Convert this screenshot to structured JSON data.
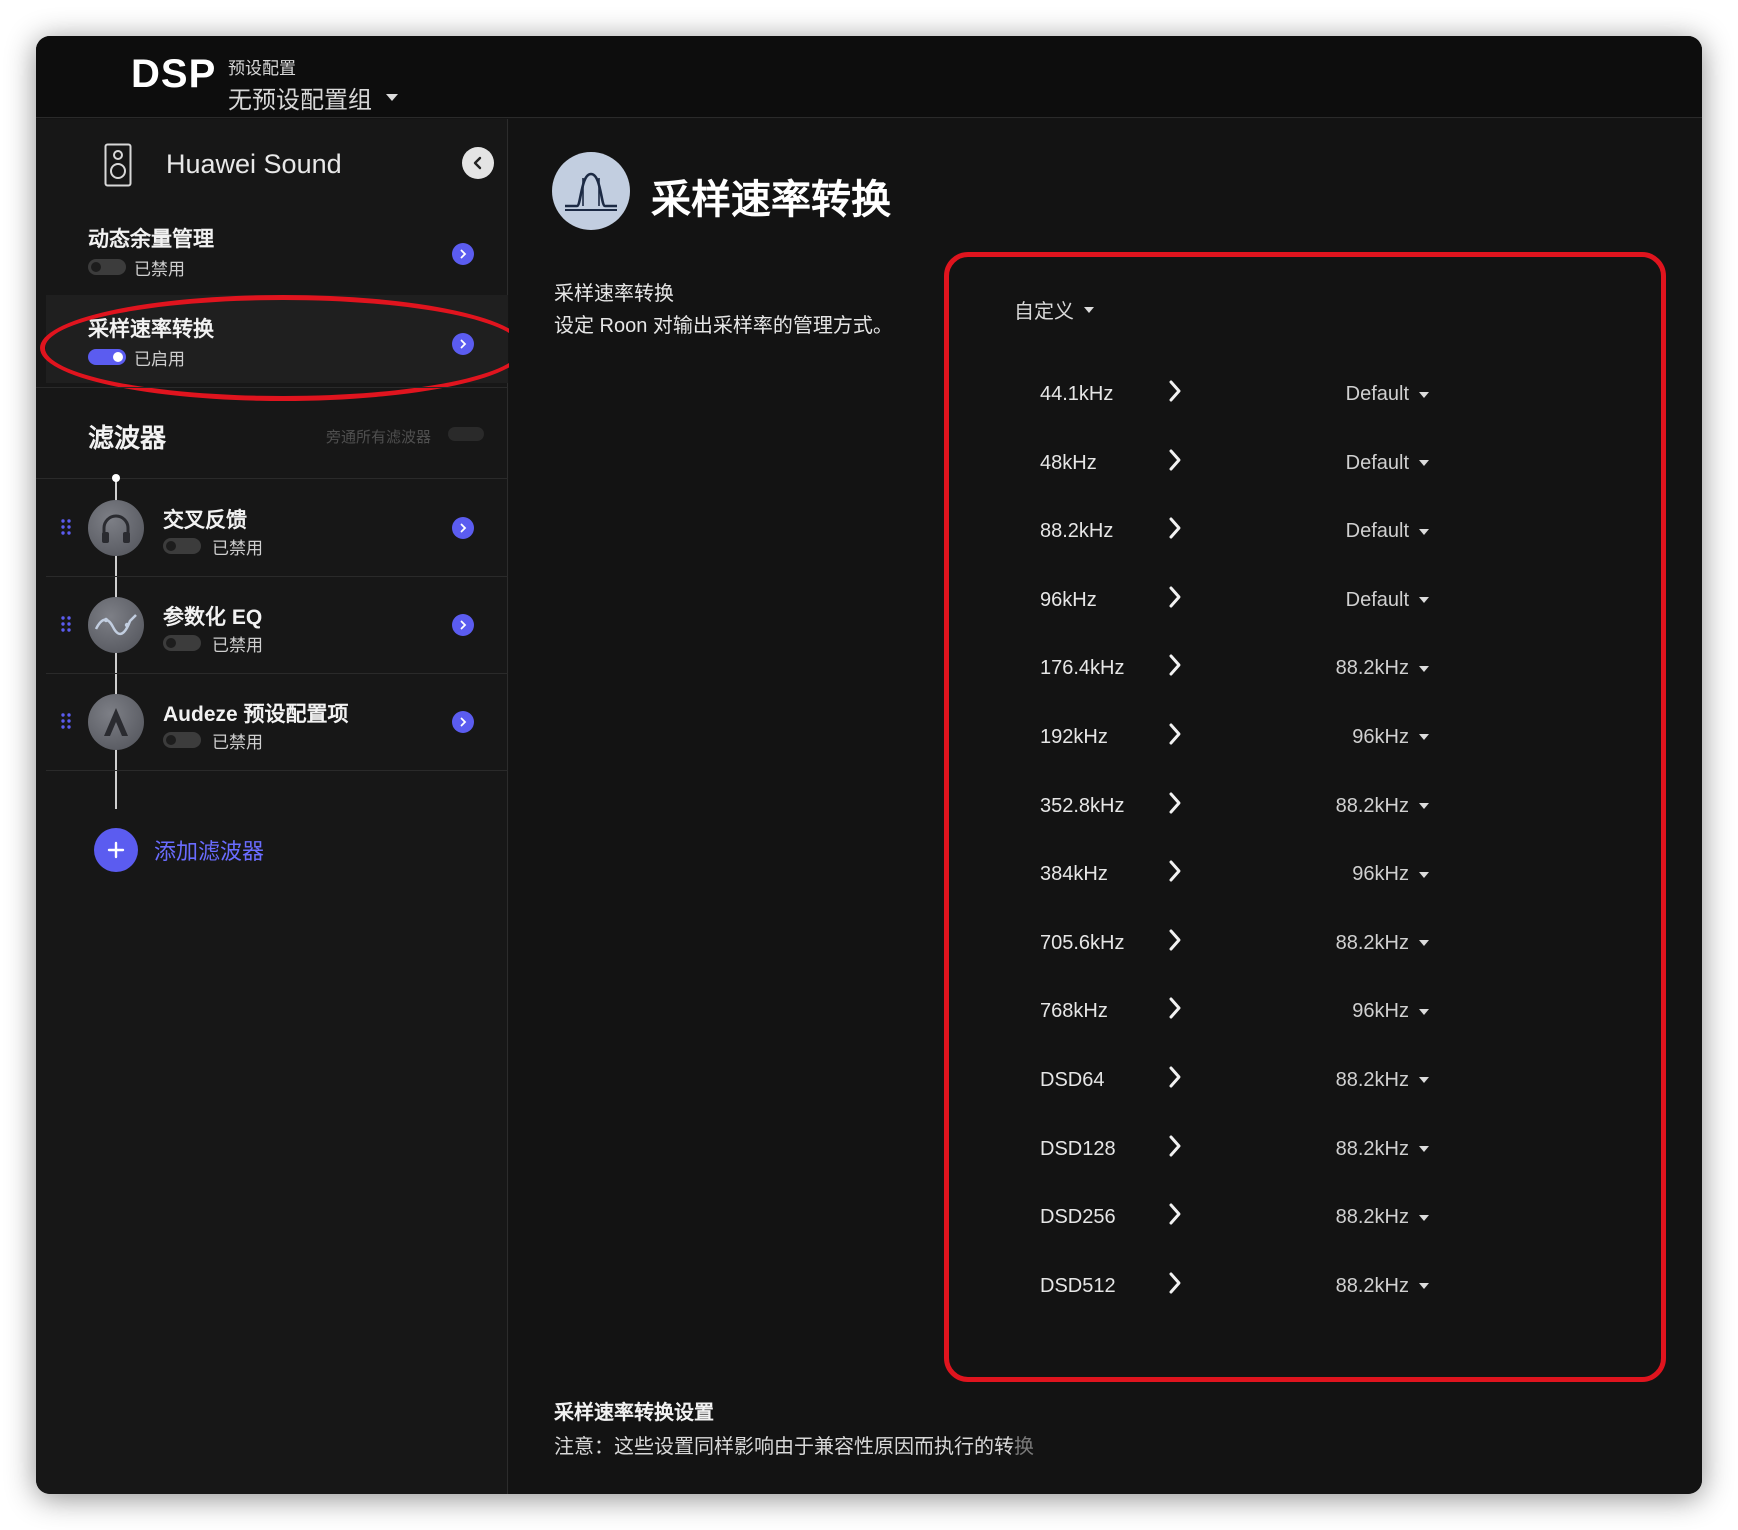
{
  "header": {
    "title": "DSP",
    "preset_caption": "预设配置",
    "preset_value": "无预设配置组"
  },
  "sidebar": {
    "device_name": "Huawei Sound",
    "items": [
      {
        "label": "动态余量管理",
        "status": "已禁用",
        "enabled": false
      },
      {
        "label": "采样速率转换",
        "status": "已启用",
        "enabled": true
      }
    ],
    "filters_title": "滤波器",
    "bypass_label": "旁通所有滤波器",
    "filters": [
      {
        "label": "交叉反馈",
        "status": "已禁用",
        "icon": "headphones-icon"
      },
      {
        "label": "参数化 EQ",
        "status": "已禁用",
        "icon": "eq-curve-icon"
      },
      {
        "label": "Audeze 预设配置项",
        "status": "已禁用",
        "icon": "audeze-logo-icon"
      }
    ],
    "add_filter_label": "添加滤波器"
  },
  "main": {
    "title": "采样速率转换",
    "desc_title": "采样速率转换",
    "desc_body": "设定 Roon 对输出采样率的管理方式。",
    "mode": "自定义",
    "rates": [
      {
        "source": "44.1kHz",
        "target": "Default"
      },
      {
        "source": "48kHz",
        "target": "Default"
      },
      {
        "source": "88.2kHz",
        "target": "Default"
      },
      {
        "source": "96kHz",
        "target": "Default"
      },
      {
        "source": "176.4kHz",
        "target": "88.2kHz"
      },
      {
        "source": "192kHz",
        "target": "96kHz"
      },
      {
        "source": "352.8kHz",
        "target": "88.2kHz"
      },
      {
        "source": "384kHz",
        "target": "96kHz"
      },
      {
        "source": "705.6kHz",
        "target": "88.2kHz"
      },
      {
        "source": "768kHz",
        "target": "96kHz"
      },
      {
        "source": "DSD64",
        "target": "88.2kHz"
      },
      {
        "source": "DSD128",
        "target": "88.2kHz"
      },
      {
        "source": "DSD256",
        "target": "88.2kHz"
      },
      {
        "source": "DSD512",
        "target": "88.2kHz"
      }
    ],
    "footer_title": "采样速率转换设置",
    "footer_note": "注意：这些设置同样影响由于兼容性原因而执行的转",
    "footer_note_faded": "换"
  },
  "colors": {
    "accent": "#5b5cf0",
    "highlight_red": "#e0141e",
    "background": "#141414"
  }
}
